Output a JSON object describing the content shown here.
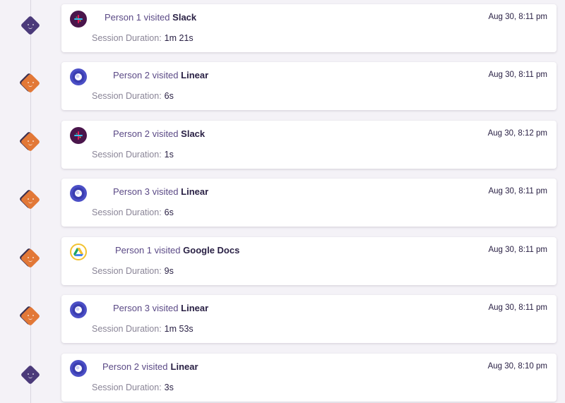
{
  "colors": {
    "marker_purple": "#4b3a7a",
    "marker_orange": "#e27837",
    "slack_bg": "#4a154b",
    "linear_bg": "#4b4fc6",
    "gdocs_ring": "#f2c230"
  },
  "activity": [
    {
      "person": "Person 1",
      "verb": "visited",
      "app": "Slack",
      "app_icon": "slack-icon",
      "timestamp": "Aug 30, 8:11 pm",
      "duration_label": "Session Duration:",
      "duration": "1m 21s",
      "marker": "purple"
    },
    {
      "person": "Person 2",
      "verb": "visited",
      "app": "Linear",
      "app_icon": "linear-icon",
      "timestamp": "Aug 30, 8:11 pm",
      "duration_label": "Session Duration:",
      "duration": "6s",
      "marker": "orange"
    },
    {
      "person": "Person 2",
      "verb": "visited",
      "app": "Slack",
      "app_icon": "slack-icon",
      "timestamp": "Aug 30, 8:12 pm",
      "duration_label": "Session Duration:",
      "duration": "1s",
      "marker": "orange"
    },
    {
      "person": "Person 3",
      "verb": "visited",
      "app": "Linear",
      "app_icon": "linear-icon",
      "timestamp": "Aug 30, 8:11 pm",
      "duration_label": "Session Duration:",
      "duration": "6s",
      "marker": "orange"
    },
    {
      "person": "Person 1",
      "verb": "visited",
      "app": "Google Docs",
      "app_icon": "google-drive-icon",
      "timestamp": "Aug 30, 8:11 pm",
      "duration_label": "Session Duration:",
      "duration": "9s",
      "marker": "orange"
    },
    {
      "person": "Person 3",
      "verb": "visited",
      "app": "Linear",
      "app_icon": "linear-icon",
      "timestamp": "Aug 30, 8:11 pm",
      "duration_label": "Session Duration:",
      "duration": "1m 53s",
      "marker": "orange"
    },
    {
      "person": "Person 2",
      "verb": "visited",
      "app": "Linear",
      "app_icon": "linear-icon",
      "timestamp": "Aug 30, 8:10 pm",
      "duration_label": "Session Duration:",
      "duration": "3s",
      "marker": "purple"
    }
  ]
}
